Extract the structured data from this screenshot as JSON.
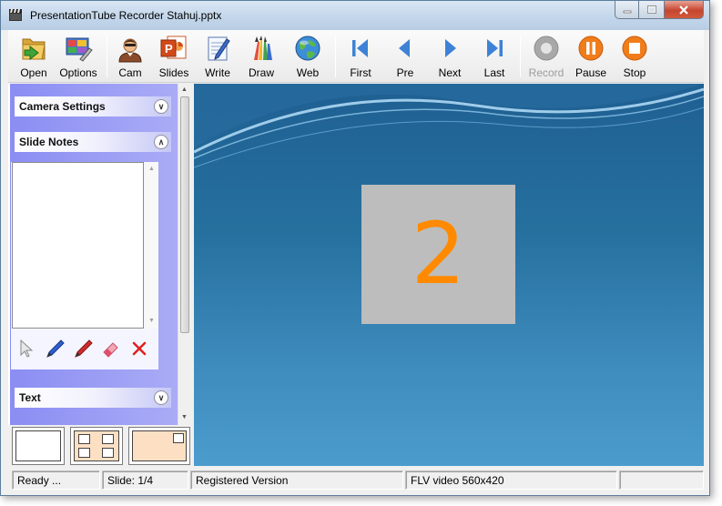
{
  "window": {
    "title": "PresentationTube Recorder Stahuj.pptx"
  },
  "toolbar": {
    "buttons": [
      {
        "label": "Open",
        "icon": "folder-open-icon"
      },
      {
        "label": "Options",
        "icon": "options-icon"
      },
      {
        "label": "Cam",
        "icon": "webcam-person-icon"
      },
      {
        "label": "Slides",
        "icon": "powerpoint-icon"
      },
      {
        "label": "Write",
        "icon": "notepad-pen-icon"
      },
      {
        "label": "Draw",
        "icon": "brushes-icon"
      },
      {
        "label": "Web",
        "icon": "globe-icon"
      },
      {
        "label": "First",
        "icon": "first-slide-icon"
      },
      {
        "label": "Pre",
        "icon": "previous-slide-icon"
      },
      {
        "label": "Next",
        "icon": "next-slide-icon"
      },
      {
        "label": "Last",
        "icon": "last-slide-icon"
      },
      {
        "label": "Record",
        "icon": "record-icon",
        "disabled": true
      },
      {
        "label": "Pause",
        "icon": "pause-icon"
      },
      {
        "label": "Stop",
        "icon": "stop-icon"
      }
    ]
  },
  "panel": {
    "camera_settings": "Camera Settings",
    "slide_notes": "Slide Notes",
    "text": "Text",
    "notes_value": ""
  },
  "stage": {
    "slide_number": "2"
  },
  "statusbar": {
    "ready": "Ready ...",
    "slide": "Slide: 1/4",
    "registration": "Registered Version",
    "video": "FLV video 560x420",
    "extra": ""
  },
  "colors": {
    "accent_orange": "#ff8a00",
    "panel_purple": "#8b8df3",
    "stage_blue": "#26719f"
  }
}
